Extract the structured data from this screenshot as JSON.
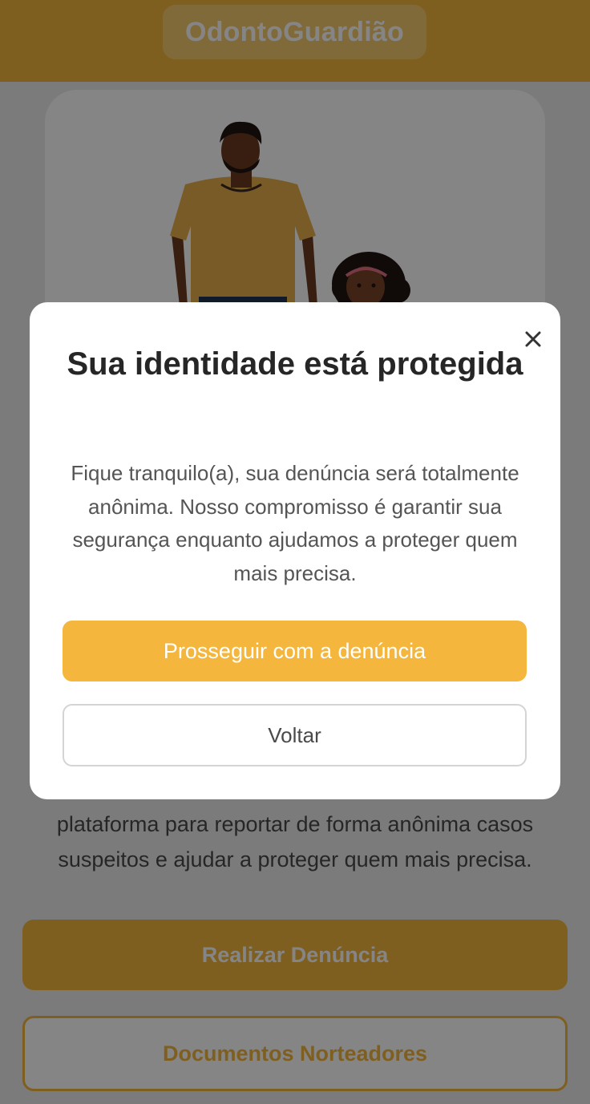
{
  "app": {
    "title": "OdontoGuardião"
  },
  "page": {
    "description": "plataforma para reportar de forma anônima casos suspeitos e ajudar a proteger quem mais precisa.",
    "primary_button": "Realizar Denúncia",
    "secondary_button": "Documentos Norteadores"
  },
  "modal": {
    "title": "Sua identidade está protegida",
    "description": "Fique tranquilo(a), sua denúncia será totalmente anônima. Nosso compromisso é garantir sua segurança enquanto ajudamos a proteger quem mais precisa.",
    "proceed_button": "Prosseguir com a denúncia",
    "back_button": "Voltar",
    "close_icon": "close-icon"
  },
  "colors": {
    "accent": "#f4b63c",
    "overlay": "rgba(0,0,0,0.48)",
    "title_text": "#262626"
  }
}
